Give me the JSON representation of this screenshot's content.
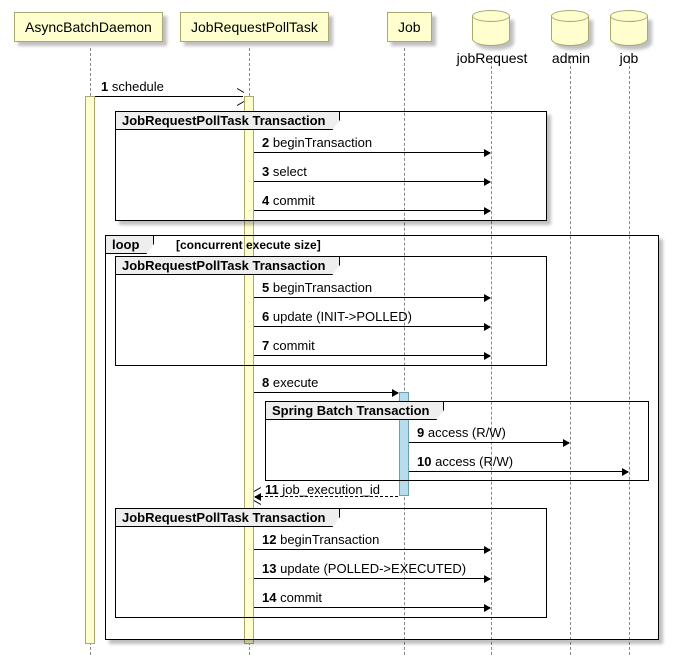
{
  "chart_data": {
    "type": "sequence-diagram",
    "participants": [
      {
        "id": "async",
        "name": "AsyncBatchDaemon",
        "kind": "actor"
      },
      {
        "id": "poll",
        "name": "JobRequestPollTask",
        "kind": "actor"
      },
      {
        "id": "job",
        "name": "Job",
        "kind": "actor"
      },
      {
        "id": "jobReq",
        "name": "jobRequest",
        "kind": "database"
      },
      {
        "id": "admin",
        "name": "admin",
        "kind": "database"
      },
      {
        "id": "jobDb",
        "name": "job",
        "kind": "database"
      }
    ],
    "messages": [
      {
        "n": 1,
        "from": "async",
        "to": "poll",
        "text": "schedule"
      },
      {
        "n": 2,
        "from": "poll",
        "to": "jobReq",
        "text": "beginTransaction"
      },
      {
        "n": 3,
        "from": "poll",
        "to": "jobReq",
        "text": "select"
      },
      {
        "n": 4,
        "from": "poll",
        "to": "jobReq",
        "text": "commit"
      },
      {
        "n": 5,
        "from": "poll",
        "to": "jobReq",
        "text": "beginTransaction"
      },
      {
        "n": 6,
        "from": "poll",
        "to": "jobReq",
        "text": "update (INIT->POLLED)"
      },
      {
        "n": 7,
        "from": "poll",
        "to": "jobReq",
        "text": "commit"
      },
      {
        "n": 8,
        "from": "poll",
        "to": "job",
        "text": "execute"
      },
      {
        "n": 9,
        "from": "job",
        "to": "admin",
        "text": "access (R/W)"
      },
      {
        "n": 10,
        "from": "job",
        "to": "jobDb",
        "text": "access (R/W)"
      },
      {
        "n": 11,
        "from": "job",
        "to": "poll",
        "text": "job_execution_id",
        "return": true
      },
      {
        "n": 12,
        "from": "poll",
        "to": "jobReq",
        "text": "beginTransaction"
      },
      {
        "n": 13,
        "from": "poll",
        "to": "jobReq",
        "text": "update (POLLED->EXECUTED)"
      },
      {
        "n": 14,
        "from": "poll",
        "to": "jobReq",
        "text": "commit"
      }
    ],
    "frames": [
      {
        "title": "JobRequestPollTask Transaction",
        "covers": [
          "poll",
          "jobReq"
        ],
        "messages": [
          2,
          3,
          4
        ]
      },
      {
        "title": "loop",
        "condition": "[concurrent execute size]",
        "covers": [
          "poll",
          "jobDb"
        ],
        "messages": [
          5,
          6,
          7,
          8,
          9,
          10,
          11,
          12,
          13,
          14
        ],
        "children": [
          {
            "title": "JobRequestPollTask Transaction",
            "covers": [
              "poll",
              "jobReq"
            ],
            "messages": [
              5,
              6,
              7
            ]
          },
          {
            "title": "Spring Batch Transaction",
            "covers": [
              "job",
              "jobDb"
            ],
            "messages": [
              9,
              10
            ]
          },
          {
            "title": "JobRequestPollTask Transaction",
            "covers": [
              "poll",
              "jobReq"
            ],
            "messages": [
              12,
              13,
              14
            ]
          }
        ]
      }
    ]
  },
  "labels": {
    "p_async": "AsyncBatchDaemon",
    "p_poll": "JobRequestPollTask",
    "p_job": "Job",
    "p_jobReq": "jobRequest",
    "p_admin": "admin",
    "p_jobDb": "job",
    "f1": "JobRequestPollTask Transaction",
    "f_loop": "loop",
    "f_loop_cond": "[concurrent execute size]",
    "f2": "JobRequestPollTask Transaction",
    "f3": "Spring Batch Transaction",
    "f4": "JobRequestPollTask Transaction",
    "m1_n": "1",
    "m1_t": "schedule",
    "m2_n": "2",
    "m2_t": "beginTransaction",
    "m3_n": "3",
    "m3_t": "select",
    "m4_n": "4",
    "m4_t": "commit",
    "m5_n": "5",
    "m5_t": "beginTransaction",
    "m6_n": "6",
    "m6_t": "update (INIT->POLLED)",
    "m7_n": "7",
    "m7_t": "commit",
    "m8_n": "8",
    "m8_t": "execute",
    "m9_n": "9",
    "m9_t": "access (R/W)",
    "m10_n": "10",
    "m10_t": "access (R/W)",
    "m11_n": "11",
    "m11_t": "job_execution_id",
    "m12_n": "12",
    "m12_t": "beginTransaction",
    "m13_n": "13",
    "m13_t": "update (POLLED->EXECUTED)",
    "m14_n": "14",
    "m14_t": "commit"
  }
}
